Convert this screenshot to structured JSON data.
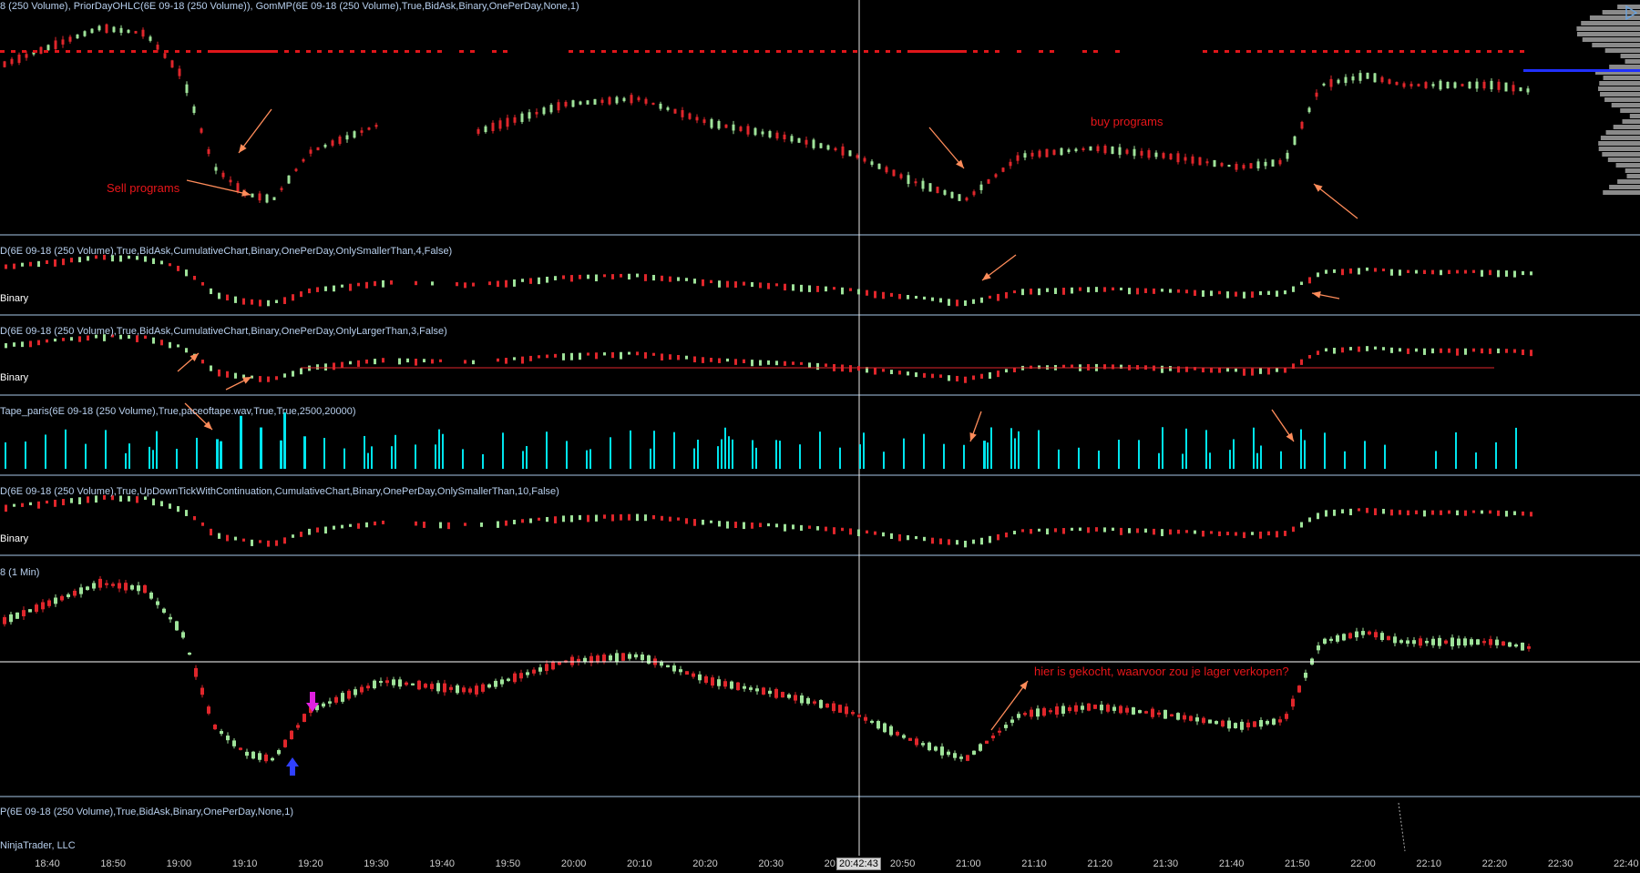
{
  "panels": [
    {
      "id": "p1",
      "label": "8 (250 Volume), PriorDayOHLC(6E 09-18 (250 Volume)), GomMP(6E 09-18 (250 Volume),True,BidAsk,Binary,OnePerDay,None,1)",
      "side": ""
    },
    {
      "id": "p2",
      "label": "D(6E 09-18 (250 Volume),True,BidAsk,CumulativeChart,Binary,OnePerDay,OnlySmallerThan,4,False)",
      "side": "Binary"
    },
    {
      "id": "p3",
      "label": "D(6E 09-18 (250 Volume),True,BidAsk,CumulativeChart,Binary,OnePerDay,OnlyLargerThan,3,False)",
      "side": "Binary"
    },
    {
      "id": "p4",
      "label": "Tape_paris(6E 09-18 (250 Volume),True,paceoftape.wav,True,True,2500,20000)",
      "side": ""
    },
    {
      "id": "p5",
      "label": "D(6E 09-18 (250 Volume),True,UpDownTickWithContinuation,CumulativeChart,Binary,OnePerDay,OnlySmallerThan,10,False)",
      "side": "Binary"
    },
    {
      "id": "p6",
      "label": "8 (1 Min)",
      "side": ""
    },
    {
      "id": "p7",
      "label": "P(6E 09-18 (250 Volume),True,BidAsk,Binary,OnePerDay,None,1)",
      "side": ""
    }
  ],
  "annotations": {
    "sell_programs": "Sell programs",
    "buy_programs": "buy programs",
    "bought_here": "hier is gekocht, waarvoor zou je lager verkopen?"
  },
  "x_axis_ticks": [
    "18:40",
    "18:50",
    "19:00",
    "19:10",
    "19:20",
    "19:30",
    "19:40",
    "19:50",
    "20:00",
    "20:10",
    "20:20",
    "20:30",
    "20:40",
    "20:50",
    "21:00",
    "21:10",
    "21:20",
    "21:30",
    "21:40",
    "21:50",
    "22:00",
    "22:10",
    "22:20",
    "22:30",
    "22:40"
  ],
  "cursor_time": "20:42:43",
  "copyright": "NinjaTrader, LLC",
  "colors": {
    "up_candle": "#9fe39a",
    "down_candle": "#e0262b",
    "separator": "#a8c8e8",
    "tape_bar": "#00e5ee",
    "arrow": "#ff8c5a",
    "prior_day_line": "#e0161a",
    "volume_profile": "#8a8a8a",
    "blue_line": "#2030ff",
    "magenta_arrow": "#e020e0",
    "blue_arrow": "#3040ff"
  },
  "icons": [
    "play-corner-icon",
    "sell-signal-arrow-icon",
    "buy-signal-arrow-icon"
  ]
}
